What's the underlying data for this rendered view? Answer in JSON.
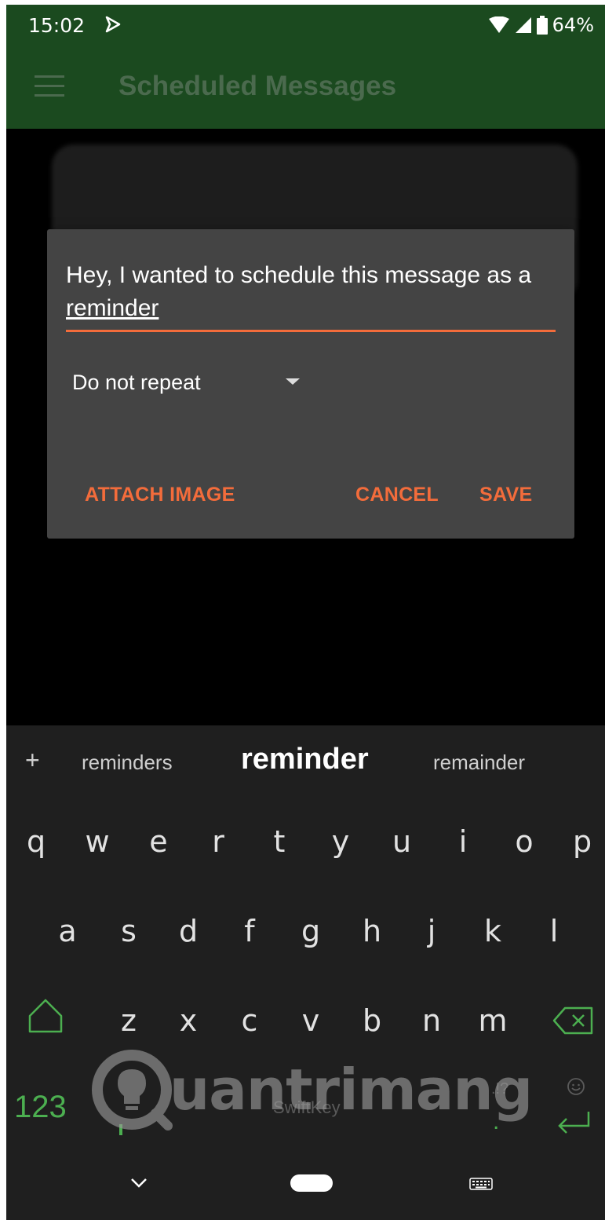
{
  "status_bar": {
    "time": "15:02",
    "battery": "64%",
    "icons": [
      "notification-icon",
      "wifi-icon",
      "signal-icon",
      "battery-icon"
    ]
  },
  "app_bar": {
    "title": "Scheduled Messages",
    "menu_icon": "hamburger-menu-icon"
  },
  "dialog": {
    "message_text_before": "Hey, I wanted to schedule this message as a ",
    "message_text_underlined": "reminder",
    "repeat_value": "Do not repeat",
    "attach_label": "ATTACH IMAGE",
    "cancel_label": "CANCEL",
    "save_label": "SAVE"
  },
  "keyboard": {
    "suggestions": [
      "reminders",
      "reminder",
      "remainder"
    ],
    "row1": [
      "q",
      "w",
      "e",
      "r",
      "t",
      "y",
      "u",
      "i",
      "o",
      "p"
    ],
    "row2": [
      "a",
      "s",
      "d",
      "f",
      "g",
      "h",
      "j",
      "k",
      "l"
    ],
    "row3": [
      "z",
      "x",
      "c",
      "v",
      "b",
      "n",
      "m"
    ],
    "numbers_key": "123",
    "space_label": "SwiftKey",
    "punct_hint": ".!?",
    "period_key": "."
  },
  "watermark": {
    "text": "uantrimang"
  },
  "colors": {
    "app_bar": "#1b4a1f",
    "accent": "#f36c3b",
    "keyboard_accent": "#4caf50",
    "dialog_bg": "#444444"
  }
}
